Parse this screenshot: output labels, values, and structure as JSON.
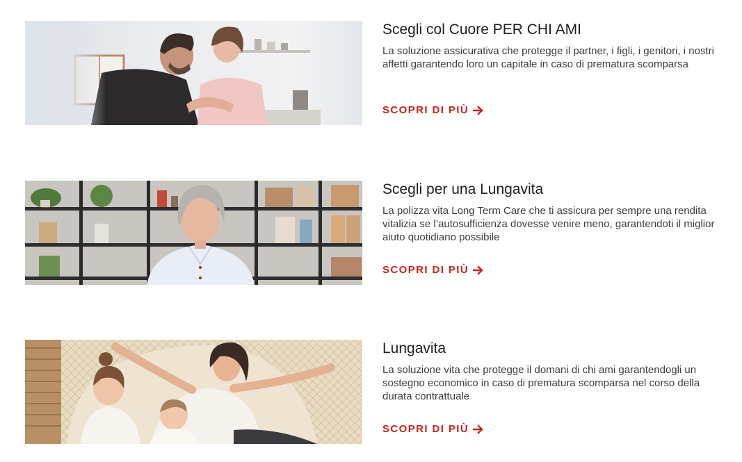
{
  "cards": [
    {
      "title": "Scegli col Cuore PER CHI AMI",
      "description": "La soluzione assicurativa che protegge il partner, i figli, i genitori, i nostri affetti garantendo loro un capitale in caso di prematura scomparsa",
      "cta_label": "SCOPRI DI PIÙ",
      "image": "couple-kitchen-photo"
    },
    {
      "title": "Scegli per una Lungavita",
      "description": "La polizza vita Long Term Care che ti assicura per sempre una rendita vitalizia se l’autosufficienza dovesse venire meno, garantendoti il miglior aiuto quotidiano possibile",
      "cta_label": "SCOPRI DI PIÙ",
      "image": "senior-woman-photo"
    },
    {
      "title": "Lungavita",
      "description": "La soluzione vita che protegge il domani di chi ami garantendogli un sostegno economico in caso di prematura scomparsa nel corso della durata contrattuale",
      "cta_label": "SCOPRI DI PIÙ",
      "image": "mother-children-photo"
    }
  ],
  "colors": {
    "accent": "#c8231c",
    "title": "#1e1e1e",
    "body": "#3d3d3d"
  },
  "icons": {
    "cta": "arrow-right-icon"
  }
}
